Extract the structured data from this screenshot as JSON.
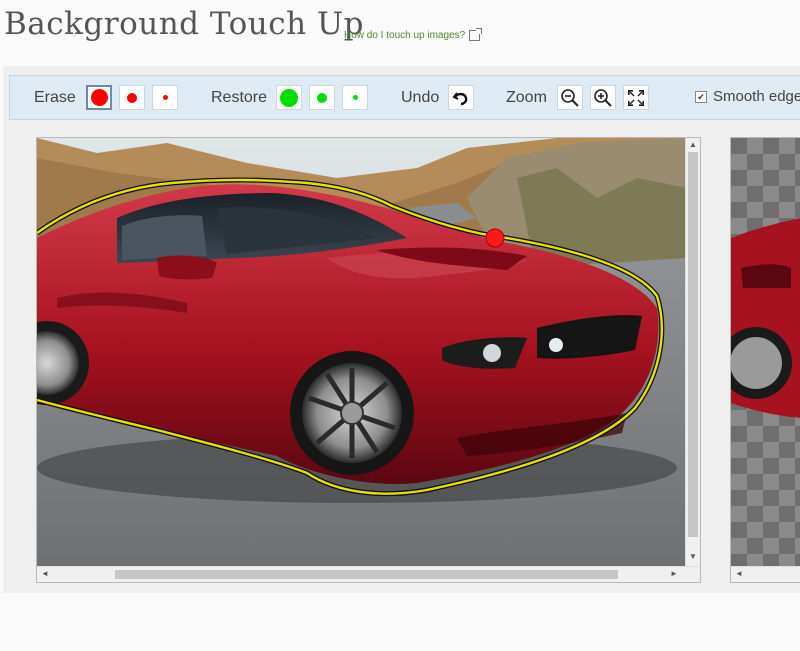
{
  "header": {
    "title": "Background Touch Up",
    "help_link": "How do I touch up images?"
  },
  "toolbar": {
    "erase_label": "Erase",
    "restore_label": "Restore",
    "undo_label": "Undo",
    "zoom_label": "Zoom",
    "smooth_label": "Smooth edge",
    "smooth_checked": true,
    "erase_color": "#ff0000",
    "restore_color": "#00dd00",
    "active_brush": "erase-large",
    "icons": [
      "undo-icon",
      "zoom-out-icon",
      "zoom-in-icon",
      "fit-screen-icon",
      "external-link-icon"
    ]
  },
  "colors": {
    "toolbar_bg": "#deeaf4",
    "outline": "#e8e000",
    "help_link": "#4c8a2c",
    "car_red": "#b01a28"
  },
  "scroll_arrows": {
    "up": "▲",
    "down": "▼",
    "left": "◄",
    "right": "►"
  }
}
